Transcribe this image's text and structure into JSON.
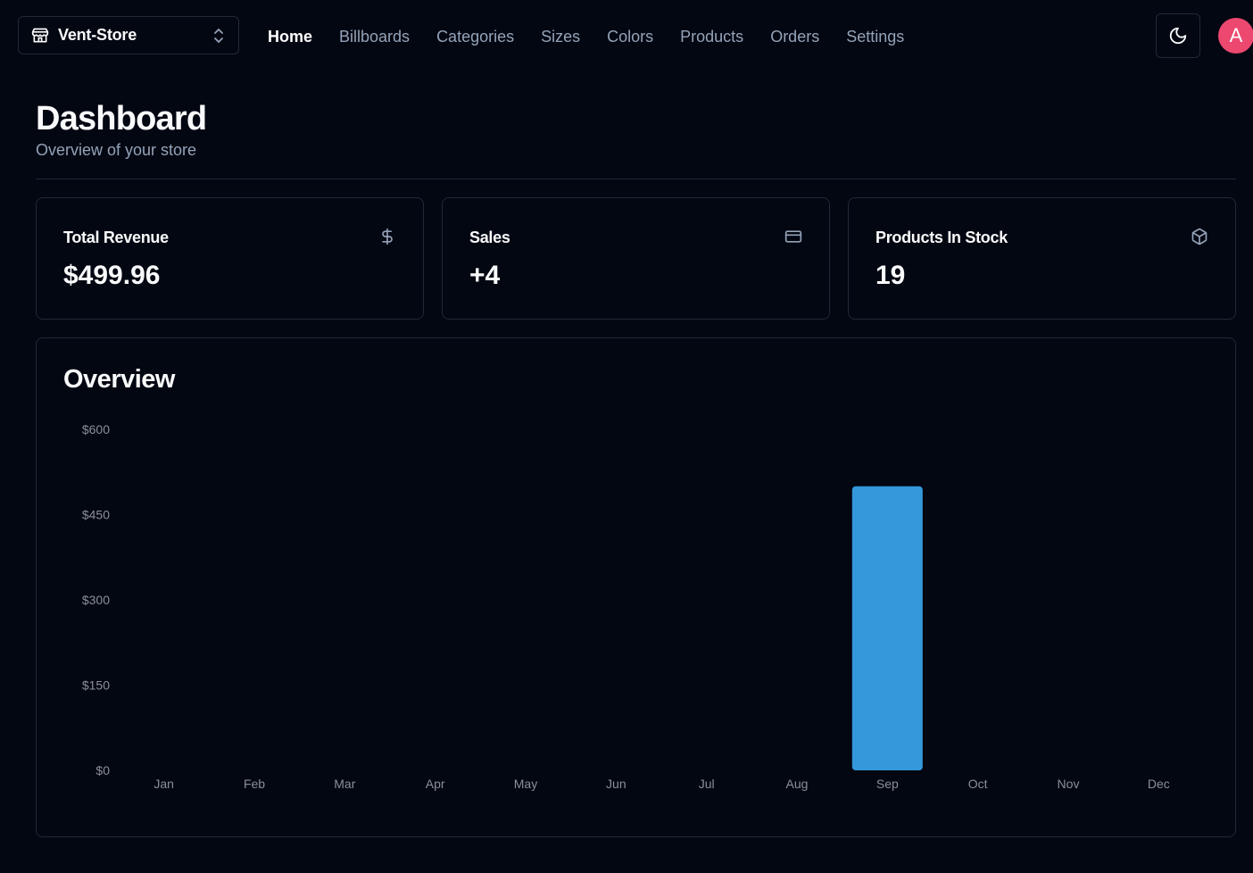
{
  "header": {
    "store_name": "Vent-Store",
    "nav": [
      {
        "label": "Home",
        "active": true
      },
      {
        "label": "Billboards",
        "active": false
      },
      {
        "label": "Categories",
        "active": false
      },
      {
        "label": "Sizes",
        "active": false
      },
      {
        "label": "Colors",
        "active": false
      },
      {
        "label": "Products",
        "active": false
      },
      {
        "label": "Orders",
        "active": false
      },
      {
        "label": "Settings",
        "active": false
      }
    ],
    "theme_icon": "moon-icon",
    "avatar_initial": "A",
    "avatar_color": "#ec4870"
  },
  "page": {
    "title": "Dashboard",
    "subtitle": "Overview of your store"
  },
  "stats": [
    {
      "title": "Total Revenue",
      "value": "$499.96",
      "icon": "dollar-icon"
    },
    {
      "title": "Sales",
      "value": "+4",
      "icon": "credit-card-icon"
    },
    {
      "title": "Products In Stock",
      "value": "19",
      "icon": "package-icon"
    }
  ],
  "overview": {
    "title": "Overview"
  },
  "chart_data": {
    "type": "bar",
    "categories": [
      "Jan",
      "Feb",
      "Mar",
      "Apr",
      "May",
      "Jun",
      "Jul",
      "Aug",
      "Sep",
      "Oct",
      "Nov",
      "Dec"
    ],
    "values": [
      0,
      0,
      0,
      0,
      0,
      0,
      0,
      0,
      499.96,
      0,
      0,
      0
    ],
    "ylim": [
      0,
      600
    ],
    "yticks": [
      "$0",
      "$150",
      "$300",
      "$450",
      "$600"
    ],
    "ytick_values": [
      0,
      150,
      300,
      450,
      600
    ],
    "bar_color": "#3498db",
    "grid": false,
    "xlabel": "",
    "ylabel": ""
  }
}
